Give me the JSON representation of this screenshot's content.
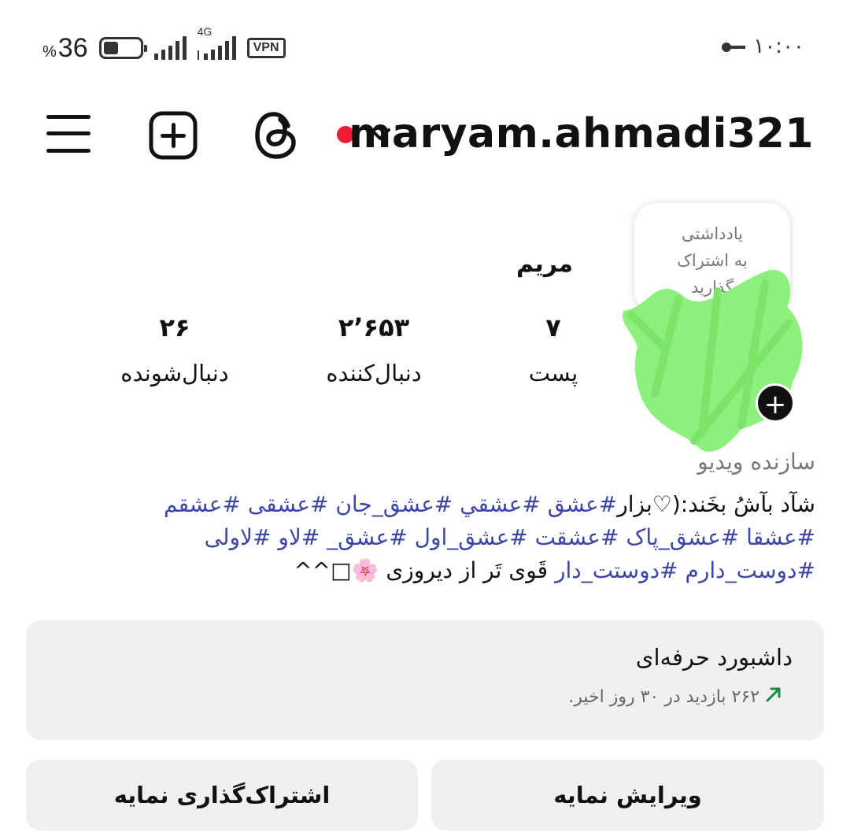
{
  "status_bar": {
    "battery_percent": "36",
    "percent_sign": "%",
    "network_type": "4G",
    "vpn_label": "VPN",
    "time": "۱۰:۰۰"
  },
  "header": {
    "username": "maryam.ahmadi321",
    "icons": [
      "menu-icon",
      "create-icon",
      "threads-icon",
      "chevron-down-icon"
    ],
    "notification_color": "#ef1d33"
  },
  "profile": {
    "note_lines": [
      "یادداشتی",
      "به اشتراک",
      "گذارید"
    ],
    "name": "مریم",
    "stats": {
      "posts": {
        "value": "۷",
        "label": "پست"
      },
      "followers": {
        "value": "۲٬۶۵۳",
        "label": "دنبال‌کننده"
      },
      "following": {
        "value": "۲۶",
        "label": "دنبال‌شونده"
      }
    },
    "category": "سازنده ویدیو",
    "bio": {
      "line1_text": "شآد بآشُ بخَند:(♡بزار",
      "line1_tags": "#عشق #عشقي #عشق_جان #عشقی #عشقم",
      "line2_tags": "#عشقا #عشق_پاک #عشقت #عشق_اول #عشق_ #لاو #لاولی",
      "line3_tags": "#دوست_دارم #دوستت_دار",
      "line3_text": "قَوی تَر از دیروزی 🌸□^^"
    }
  },
  "dashboard": {
    "title": "داشبورد حرفه‌ای",
    "subtitle": "۲۶۲ بازدید در ۳۰ روز اخیر.",
    "trend_color": "#1a8a3c"
  },
  "buttons": {
    "edit_profile": "ویرایش نمایه",
    "share_profile": "اشتراک‌گذاری نمایه"
  }
}
